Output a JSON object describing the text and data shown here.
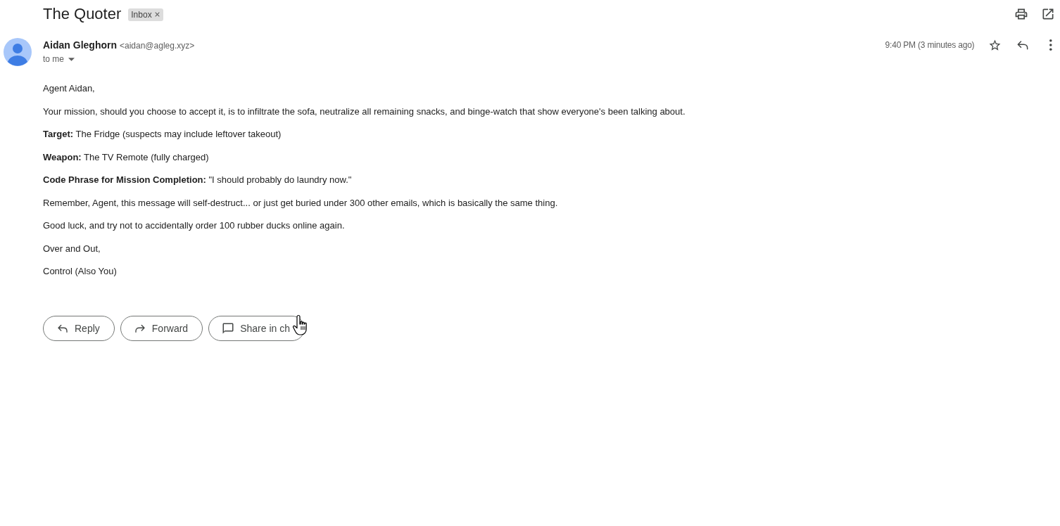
{
  "thread": {
    "subject": "The Quoter",
    "labels": [
      {
        "text": "Inbox",
        "removable": true
      }
    ]
  },
  "message": {
    "sender_name": "Aidan Gleghorn",
    "sender_email": "<aidan@agleg.xyz>",
    "recipient": "to me",
    "time": "9:40 PM (3 minutes ago)",
    "starred": false,
    "body": [
      "Agent Aidan,",
      "Your mission, should you choose to accept it, is to infiltrate the sofa, neutralize all remaining snacks, and binge-watch that show everyone's been talking about.",
      "**Target:** The Fridge (suspects may include leftover takeout)",
      "**Weapon:** The TV Remote (fully charged)",
      "**Code Phrase for Mission Completion:** \"I should probably do laundry now.\"",
      "Remember, Agent, this message will self-destruct... or just get buried under 300 other emails, which is basically the same thing.",
      "Good luck, and try not to accidentally order 100 rubber ducks online again.",
      "Over and Out,",
      "Control (Also You)"
    ]
  },
  "actions": [
    {
      "kind": "reply",
      "label": "Reply"
    },
    {
      "kind": "forward",
      "label": "Forward"
    },
    {
      "kind": "chat",
      "label": "Share in ch"
    }
  ]
}
